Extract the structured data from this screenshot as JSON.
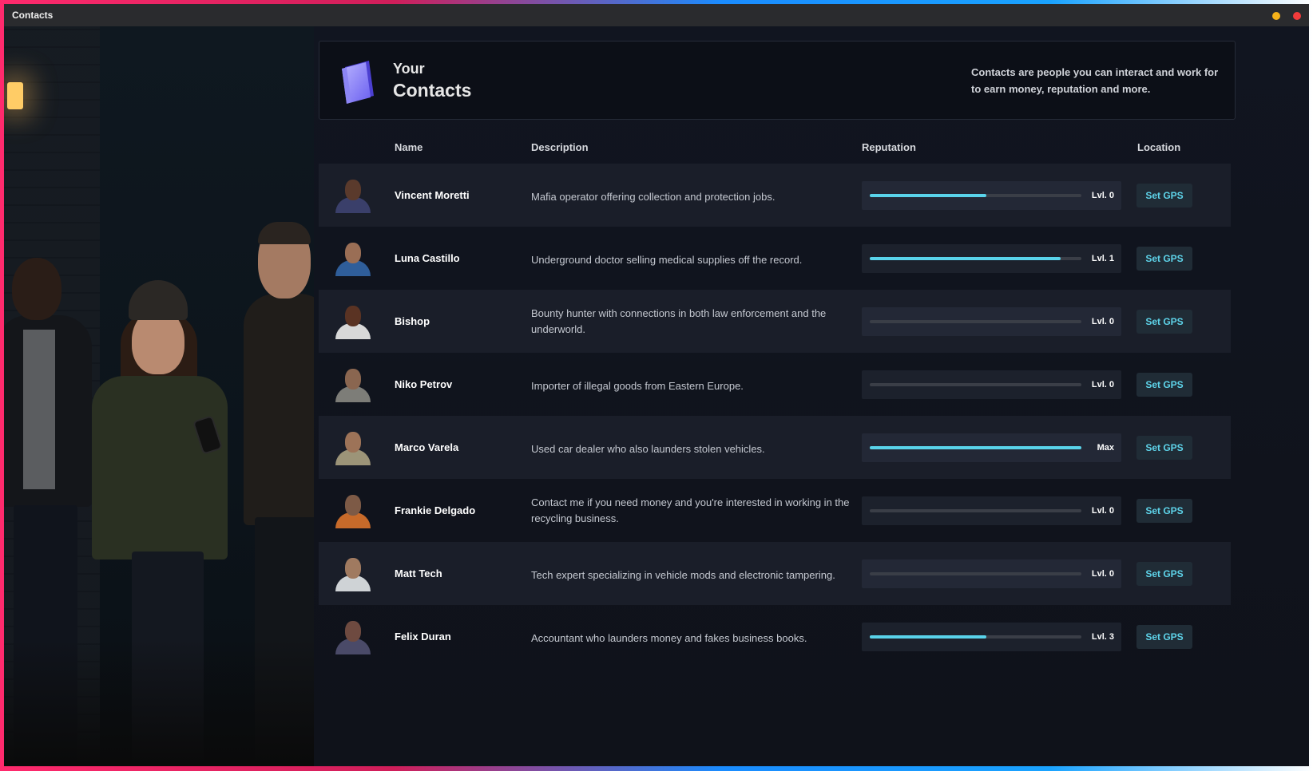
{
  "window": {
    "title": "Contacts"
  },
  "header": {
    "title_small": "Your",
    "title_big": "Contacts",
    "description": "Contacts are people you can interact and work for to earn money, reputation and more."
  },
  "table": {
    "columns": {
      "name": "Name",
      "description": "Description",
      "reputation": "Reputation",
      "location": "Location"
    }
  },
  "contacts": [
    {
      "name": "Vincent Moretti",
      "description": "Mafia operator offering collection and protection jobs.",
      "level": "Lvl. 0",
      "progress": 0.55,
      "gps": "Set GPS"
    },
    {
      "name": "Luna Castillo",
      "description": "Underground doctor selling medical supplies off the record.",
      "level": "Lvl. 1",
      "progress": 0.9,
      "gps": "Set GPS"
    },
    {
      "name": "Bishop",
      "description": "Bounty hunter with connections in both law enforcement and the underworld.",
      "level": "Lvl. 0",
      "progress": 0,
      "gps": "Set GPS"
    },
    {
      "name": "Niko Petrov",
      "description": "Importer of illegal goods from Eastern Europe.",
      "level": "Lvl. 0",
      "progress": 0,
      "gps": "Set GPS"
    },
    {
      "name": "Marco Varela",
      "description": "Used car dealer who also launders stolen vehicles.",
      "level": "Max",
      "progress": 1.0,
      "gps": "Set GPS"
    },
    {
      "name": "Frankie Delgado",
      "description": "Contact me if you need money and you're interested in working in the recycling business.",
      "level": "Lvl. 0",
      "progress": 0,
      "gps": "Set GPS"
    },
    {
      "name": "Matt Tech",
      "description": "Tech expert specializing in vehicle mods and electronic tampering.",
      "level": "Lvl. 0",
      "progress": 0,
      "gps": "Set GPS"
    },
    {
      "name": "Felix Duran",
      "description": "Accountant who launders money and fakes business books.",
      "level": "Lvl. 3",
      "progress": 0.55,
      "gps": "Set GPS"
    }
  ],
  "colors": {
    "accent": "#59d3ea",
    "background": "#0f121a",
    "row_alt": "#1a1e29"
  }
}
